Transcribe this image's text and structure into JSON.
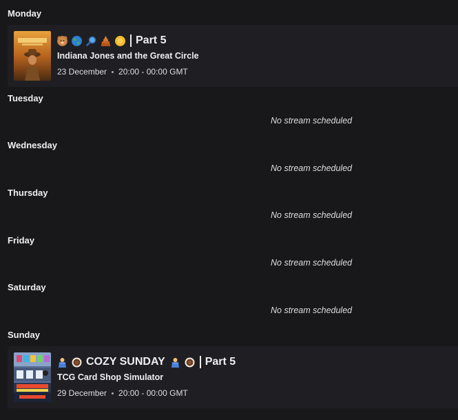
{
  "days": {
    "monday": {
      "label": "Monday",
      "stream": {
        "emojis": [
          "bear-face",
          "globe",
          "magnifying-glass",
          "temple",
          "coin"
        ],
        "part": "Part 5",
        "game": "Indiana Jones and the Great Circle",
        "date": "23 December",
        "time": "20:00 - 00:00 GMT"
      }
    },
    "tuesday": {
      "label": "Tuesday",
      "empty": "No stream scheduled"
    },
    "wednesday": {
      "label": "Wednesday",
      "empty": "No stream scheduled"
    },
    "thursday": {
      "label": "Thursday",
      "empty": "No stream scheduled"
    },
    "friday": {
      "label": "Friday",
      "empty": "No stream scheduled"
    },
    "saturday": {
      "label": "Saturday",
      "empty": "No stream scheduled"
    },
    "sunday": {
      "label": "Sunday",
      "stream": {
        "title": "COZY SUNDAY",
        "emojis": [
          "person-blanket",
          "coffee"
        ],
        "part": "Part 5",
        "game": "TCG Card Shop Simulator",
        "date": "29 December",
        "time": "20:00 - 00:00 GMT"
      }
    }
  },
  "colors": {
    "background": "#18181b",
    "card": "#1f1f23",
    "text": "#efeff1"
  }
}
